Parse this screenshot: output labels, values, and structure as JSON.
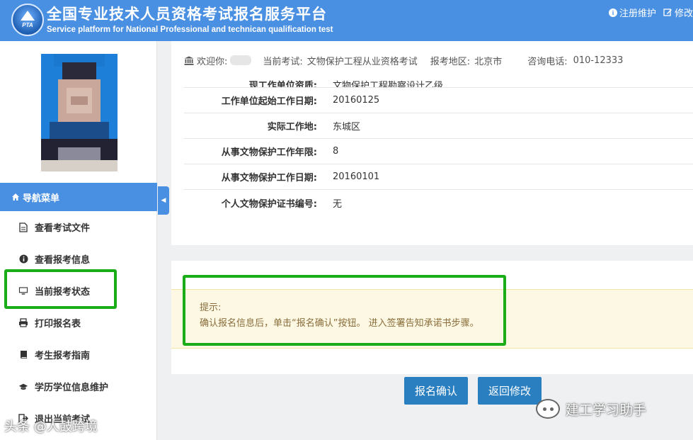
{
  "header": {
    "logo_text": "PTA",
    "title": "全国专业技术人员资格考试报名服务平台",
    "subtitle": "Service platform for National Professional and technican qualification test",
    "links": [
      {
        "icon": "info-circle-icon",
        "label": "注册维护"
      },
      {
        "icon": "edit-icon",
        "label": "修改"
      }
    ]
  },
  "sidebar": {
    "nav_header": "导航菜单",
    "nav_header_icon": "home-icon",
    "items": [
      {
        "icon": "file-icon",
        "label": "查看考试文件"
      },
      {
        "icon": "info-icon",
        "label": "查看报考信息"
      },
      {
        "icon": "monitor-icon",
        "label": "当前报考状态"
      },
      {
        "icon": "print-icon",
        "label": "打印报名表"
      },
      {
        "icon": "book-icon",
        "label": "考生报考指南"
      },
      {
        "icon": "graduation-cap-icon",
        "label": "学历学位信息维护"
      },
      {
        "icon": "exit-icon",
        "label": "退出当前考试"
      }
    ]
  },
  "welcome": {
    "greeting": "欢迎你:",
    "exam_label": "当前考试:",
    "exam_value": "文物保护工程从业资格考试",
    "region_label": "报考地区:",
    "region_value": "北京市",
    "phone_label": "咨询电话:",
    "phone_value": "010-12333"
  },
  "details": [
    {
      "label": "现工作单位资质:",
      "value": "文物保护工程勘察设计乙级"
    },
    {
      "label": "工作单位起始工作日期:",
      "value": "20160125"
    },
    {
      "label": "实际工作地:",
      "value": "东城区"
    },
    {
      "label": "从事文物保护工作年限:",
      "value": "8"
    },
    {
      "label": "从事文物保护工作日期:",
      "value": "20160101"
    },
    {
      "label": "个人文物保护证书编号:",
      "value": "无"
    }
  ],
  "tip": {
    "title": "提示:",
    "text": "确认报名信息后，单击“报名确认”按钮。 进入签署告知承诺书步骤。"
  },
  "buttons": {
    "confirm": "报名确认",
    "back": "返回修改"
  },
  "watermarks": {
    "right": "建工学习助手",
    "left": "头条 @人鼓跨境"
  },
  "colors": {
    "header_bg": "#4a90e2",
    "button_bg": "#2a7fc1",
    "tip_bg": "#fcf8e3",
    "highlight": "#1aad19"
  }
}
